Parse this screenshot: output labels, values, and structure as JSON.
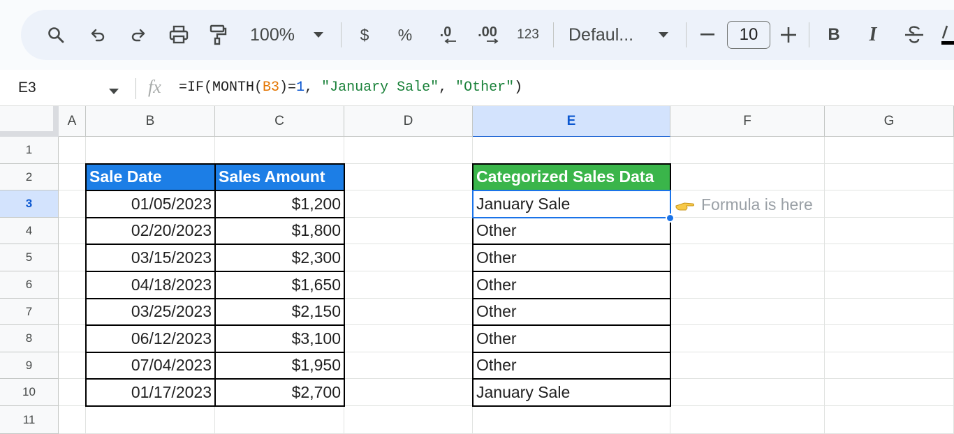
{
  "toolbar": {
    "zoom": "100%",
    "currency": "$",
    "percent": "%",
    "decrease_decimal": ".0",
    "increase_decimal": ".00",
    "number_format": "123",
    "font": "Defaul...",
    "font_size": "10",
    "bold": "B",
    "italic": "I"
  },
  "formula_bar": {
    "cell_ref": "E3",
    "fx": "fx",
    "formula_parts": [
      "=IF(MONTH(",
      "B3",
      ")=",
      "1",
      ", ",
      "\"January Sale\"",
      ", ",
      "\"Other\"",
      ")"
    ]
  },
  "columns": [
    "A",
    "B",
    "C",
    "D",
    "E",
    "F",
    "G"
  ],
  "rows": [
    "1",
    "2",
    "3",
    "4",
    "5",
    "6",
    "7",
    "8",
    "9",
    "10",
    "11"
  ],
  "table_left": {
    "headers": [
      "Sale Date",
      "Sales Amount"
    ],
    "rows": [
      [
        "01/05/2023",
        "$1,200"
      ],
      [
        "02/20/2023",
        "$1,800"
      ],
      [
        "03/15/2023",
        "$2,300"
      ],
      [
        "04/18/2023",
        "$1,650"
      ],
      [
        "03/25/2023",
        "$2,150"
      ],
      [
        "06/12/2023",
        "$3,100"
      ],
      [
        "07/04/2023",
        "$1,950"
      ],
      [
        "01/17/2023",
        "$2,700"
      ]
    ]
  },
  "table_right": {
    "header": "Categorized Sales Data",
    "rows": [
      "January Sale",
      "Other",
      "Other",
      "Other",
      "Other",
      "Other",
      "Other",
      "January Sale"
    ]
  },
  "annotation": "Formula is here",
  "colors": {
    "blue_header": "#1c7ee6",
    "green_header": "#3ab54a",
    "selection": "#1a73e8"
  }
}
